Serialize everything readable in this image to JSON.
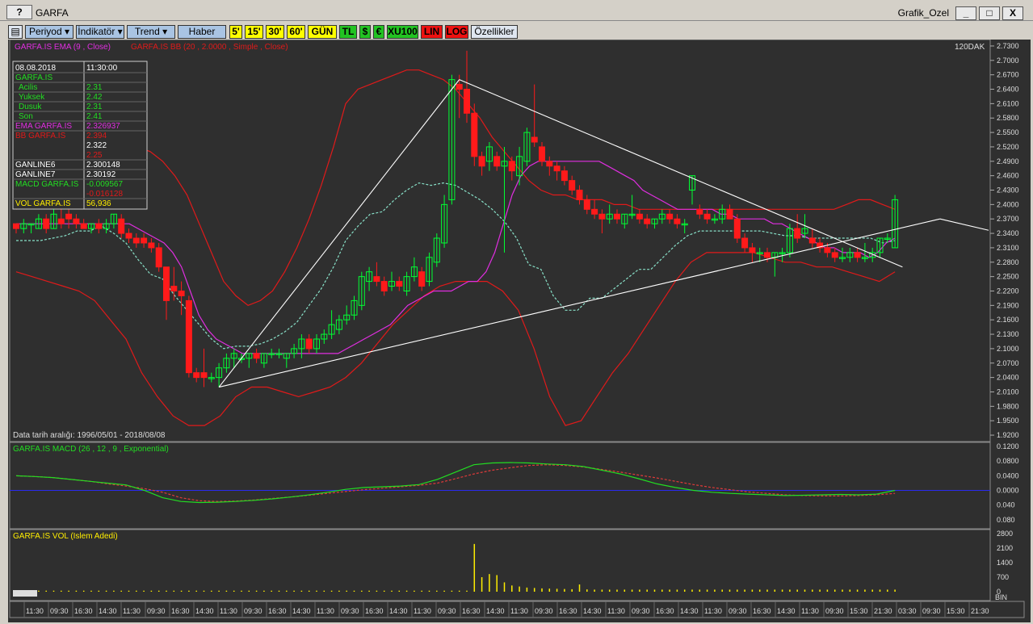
{
  "window": {
    "help_label": "?",
    "symbol": "GARFA",
    "template": "Grafik_Ozel",
    "min_label": "_",
    "max_label": "□",
    "close_label": "X"
  },
  "toolbar": {
    "periyod": "Periyod",
    "indikator": "İndikatör",
    "trend": "Trend",
    "haber": "Haber",
    "p5": "5'",
    "p15": "15'",
    "p30": "30'",
    "p60": "60'",
    "gun": "GÜN",
    "tl": "TL",
    "usd": "$",
    "eur": "€",
    "xu100": "XU100",
    "lin": "LIN",
    "log": "LOG",
    "ozellikler": "Özellikler"
  },
  "main_panel": {
    "legend_ema": "GARFA.IS EMA (9 , Close)",
    "legend_bb": "GARFA.IS BB (20 , 2.0000 , Simple , Close)",
    "interval_label": "120DAK",
    "date_range": "Data tarih aralığı: 1996/05/01 - 2018/08/08"
  },
  "info_box": {
    "date": "08.08.2018",
    "time": "11:30:00",
    "symbol": "GARFA.IS",
    "rows": [
      {
        "label": "Acilis",
        "value": "2.31"
      },
      {
        "label": "Yuksek",
        "value": "2.42"
      },
      {
        "label": "Dusuk",
        "value": "2.31"
      },
      {
        "label": "Son",
        "value": "2.41"
      }
    ],
    "ema_label": "EMA GARFA.IS",
    "ema_value": "2.326937",
    "bb_label": "BB GARFA.IS",
    "bb_upper": "2.394",
    "bb_mid": "2.322",
    "bb_lower": "2.25",
    "ganline6_label": "GANLINE6",
    "ganline6_value": "2.300148",
    "ganline7_label": "GANLINE7",
    "ganline7_value": "2.30192",
    "macd_label": "MACD GARFA.IS",
    "macd_value": "-0.009567",
    "macd_signal": "-0.016128",
    "vol_label": "VOL GARFA.IS",
    "vol_value": "56,936"
  },
  "macd_panel": {
    "legend": "GARFA.IS MACD (26 , 12 , 9 , Exponential)"
  },
  "vol_panel": {
    "legend": "GARFA.IS VOL (Islem Adedi)",
    "unit": "BIN"
  },
  "price_ticks": [
    "2.7300",
    "2.7000",
    "2.6700",
    "2.6400",
    "2.6100",
    "2.5800",
    "2.5500",
    "2.5200",
    "2.4900",
    "2.4600",
    "2.4300",
    "2.4000",
    "2.3700",
    "2.3400",
    "2.3100",
    "2.2800",
    "2.2500",
    "2.2200",
    "2.1900",
    "2.1600",
    "2.1300",
    "2.1000",
    "2.0700",
    "2.0400",
    "2.0100",
    "1.9800",
    "1.9500",
    "1.9200"
  ],
  "macd_ticks": [
    "0.1200",
    "0.0800",
    "0.0400",
    "0.0000",
    "0.040",
    "0.080"
  ],
  "vol_ticks": [
    "2800",
    "2100",
    "1400",
    "700",
    "0"
  ],
  "time_labels": [
    "11:30",
    "09:30",
    "16:30",
    "14:30",
    "11:30",
    "09:30",
    "16:30",
    "14:30",
    "11:30",
    "09:30",
    "16:30",
    "14:30",
    "11:30",
    "09:30",
    "16:30",
    "14:30",
    "11:30",
    "09:30",
    "16:30",
    "14:30",
    "11:30",
    "09:30",
    "16:30",
    "14:30",
    "11:30",
    "09:30",
    "16:30",
    "14:30",
    "11:30",
    "09:30",
    "16:30",
    "14:30",
    "11:30",
    "09:30",
    "15:30",
    "21:30",
    "03:30",
    "09:30",
    "15:30",
    "21:30"
  ],
  "colors": {
    "bg": "#2f2f2f",
    "up": "#00ff33",
    "down": "#ff1a1a",
    "ema": "#e02ee0",
    "bb": "#e01a1a",
    "midband": "#88e0c8",
    "trend": "#ffffff",
    "macd": "#22dd22",
    "signal": "#e03a3a",
    "vol": "#ffee00",
    "zero": "#2a2aee"
  },
  "chart_data": {
    "type": "candlestick",
    "ylim": [
      1.91,
      2.74
    ],
    "candles": [
      [
        2.36,
        2.36,
        2.34,
        2.35
      ],
      [
        2.35,
        2.37,
        2.34,
        2.36
      ],
      [
        2.36,
        2.36,
        2.34,
        2.36
      ],
      [
        2.35,
        2.38,
        2.35,
        2.37
      ],
      [
        2.37,
        2.38,
        2.34,
        2.35
      ],
      [
        2.35,
        2.39,
        2.35,
        2.38
      ],
      [
        2.37,
        2.39,
        2.35,
        2.36
      ],
      [
        2.38,
        2.39,
        2.35,
        2.37
      ],
      [
        2.37,
        2.38,
        2.35,
        2.36
      ],
      [
        2.36,
        2.37,
        2.35,
        2.35
      ],
      [
        2.35,
        2.36,
        2.34,
        2.36
      ],
      [
        2.36,
        2.37,
        2.34,
        2.35
      ],
      [
        2.35,
        2.37,
        2.34,
        2.36
      ],
      [
        2.36,
        2.38,
        2.35,
        2.38
      ],
      [
        2.37,
        2.38,
        2.33,
        2.34
      ],
      [
        2.34,
        2.35,
        2.32,
        2.33
      ],
      [
        2.33,
        2.34,
        2.31,
        2.32
      ],
      [
        2.33,
        2.34,
        2.31,
        2.32
      ],
      [
        2.32,
        2.33,
        2.3,
        2.31
      ],
      [
        2.31,
        2.32,
        2.26,
        2.27
      ],
      [
        2.27,
        2.27,
        2.16,
        2.2
      ],
      [
        2.23,
        2.27,
        2.2,
        2.22
      ],
      [
        2.22,
        2.24,
        2.17,
        2.21
      ],
      [
        2.2,
        2.21,
        2.04,
        2.05
      ],
      [
        2.05,
        2.06,
        2.03,
        2.04
      ],
      [
        2.05,
        2.1,
        2.02,
        2.04
      ],
      [
        2.04,
        2.05,
        2.03,
        2.04
      ],
      [
        2.04,
        2.07,
        2.02,
        2.06
      ],
      [
        2.06,
        2.09,
        2.05,
        2.08
      ],
      [
        2.08,
        2.1,
        2.06,
        2.09
      ],
      [
        2.08,
        2.09,
        2.07,
        2.08
      ],
      [
        2.08,
        2.09,
        2.06,
        2.09
      ],
      [
        2.09,
        2.1,
        2.07,
        2.08
      ],
      [
        2.07,
        2.09,
        2.06,
        2.09
      ],
      [
        2.09,
        2.1,
        2.08,
        2.09
      ],
      [
        2.09,
        2.1,
        2.08,
        2.09
      ],
      [
        2.08,
        2.09,
        2.06,
        2.09
      ],
      [
        2.09,
        2.11,
        2.08,
        2.1
      ],
      [
        2.1,
        2.13,
        2.08,
        2.12
      ],
      [
        2.12,
        2.13,
        2.09,
        2.1
      ],
      [
        2.1,
        2.13,
        2.09,
        2.12
      ],
      [
        2.12,
        2.14,
        2.11,
        2.13
      ],
      [
        2.13,
        2.18,
        2.12,
        2.15
      ],
      [
        2.14,
        2.17,
        2.13,
        2.16
      ],
      [
        2.16,
        2.19,
        2.15,
        2.17
      ],
      [
        2.17,
        2.21,
        2.16,
        2.2
      ],
      [
        2.19,
        2.26,
        2.18,
        2.25
      ],
      [
        2.24,
        2.27,
        2.22,
        2.26
      ],
      [
        2.25,
        2.28,
        2.23,
        2.24
      ],
      [
        2.24,
        2.25,
        2.21,
        2.22
      ],
      [
        2.23,
        2.26,
        2.22,
        2.24
      ],
      [
        2.24,
        2.25,
        2.22,
        2.23
      ],
      [
        2.22,
        2.26,
        2.21,
        2.25
      ],
      [
        2.25,
        2.29,
        2.24,
        2.27
      ],
      [
        2.26,
        2.27,
        2.22,
        2.23
      ],
      [
        2.24,
        2.3,
        2.23,
        2.29
      ],
      [
        2.28,
        2.34,
        2.27,
        2.33
      ],
      [
        2.32,
        2.42,
        2.31,
        2.4
      ],
      [
        2.41,
        2.67,
        2.4,
        2.66
      ],
      [
        2.65,
        2.67,
        2.58,
        2.64
      ],
      [
        2.64,
        2.72,
        2.57,
        2.59
      ],
      [
        2.59,
        2.61,
        2.48,
        2.5
      ],
      [
        2.5,
        2.51,
        2.46,
        2.48
      ],
      [
        2.49,
        2.53,
        2.47,
        2.52
      ],
      [
        2.5,
        2.51,
        2.47,
        2.48
      ],
      [
        2.48,
        2.52,
        2.3,
        2.49
      ],
      [
        2.49,
        2.5,
        2.45,
        2.47
      ],
      [
        2.46,
        2.52,
        2.44,
        2.5
      ],
      [
        2.49,
        2.56,
        2.48,
        2.55
      ],
      [
        2.54,
        2.65,
        2.52,
        2.53
      ],
      [
        2.52,
        2.53,
        2.48,
        2.49
      ],
      [
        2.49,
        2.5,
        2.46,
        2.48
      ],
      [
        2.48,
        2.49,
        2.45,
        2.47
      ],
      [
        2.47,
        2.48,
        2.44,
        2.45
      ],
      [
        2.45,
        2.46,
        2.42,
        2.43
      ],
      [
        2.43,
        2.44,
        2.4,
        2.41
      ],
      [
        2.41,
        2.42,
        2.38,
        2.39
      ],
      [
        2.39,
        2.41,
        2.37,
        2.38
      ],
      [
        2.38,
        2.39,
        2.34,
        2.37
      ],
      [
        2.37,
        2.4,
        2.36,
        2.38
      ],
      [
        2.38,
        2.39,
        2.36,
        2.37
      ],
      [
        2.36,
        2.38,
        2.35,
        2.38
      ],
      [
        2.38,
        2.42,
        2.37,
        2.38
      ],
      [
        2.38,
        2.39,
        2.36,
        2.37
      ],
      [
        2.37,
        2.38,
        2.35,
        2.36
      ],
      [
        2.36,
        2.37,
        2.35,
        2.37
      ],
      [
        2.37,
        2.39,
        2.36,
        2.38
      ],
      [
        2.38,
        2.39,
        2.36,
        2.37
      ],
      [
        2.37,
        2.38,
        2.35,
        2.36
      ],
      [
        2.36,
        2.37,
        2.34,
        2.36
      ],
      [
        2.43,
        2.46,
        2.4,
        2.46
      ],
      [
        2.39,
        2.4,
        2.37,
        2.38
      ],
      [
        2.38,
        2.39,
        2.36,
        2.37
      ],
      [
        2.37,
        2.38,
        2.36,
        2.37
      ],
      [
        2.37,
        2.4,
        2.36,
        2.39
      ],
      [
        2.39,
        2.4,
        2.37,
        2.37
      ],
      [
        2.37,
        2.38,
        2.32,
        2.33
      ],
      [
        2.33,
        2.34,
        2.3,
        2.31
      ],
      [
        2.31,
        2.32,
        2.28,
        2.3
      ],
      [
        2.3,
        2.31,
        2.28,
        2.3
      ],
      [
        2.3,
        2.31,
        2.28,
        2.29
      ],
      [
        2.29,
        2.3,
        2.25,
        2.3
      ],
      [
        2.3,
        2.31,
        2.28,
        2.3
      ],
      [
        2.3,
        2.36,
        2.29,
        2.35
      ],
      [
        2.35,
        2.38,
        2.32,
        2.33
      ],
      [
        2.34,
        2.38,
        2.33,
        2.35
      ],
      [
        2.33,
        2.35,
        2.31,
        2.32
      ],
      [
        2.32,
        2.33,
        2.3,
        2.31
      ],
      [
        2.31,
        2.32,
        2.29,
        2.3
      ],
      [
        2.3,
        2.31,
        2.28,
        2.29
      ],
      [
        2.29,
        2.31,
        2.28,
        2.29
      ],
      [
        2.29,
        2.31,
        2.28,
        2.3
      ],
      [
        2.3,
        2.31,
        2.28,
        2.29
      ],
      [
        2.29,
        2.32,
        2.28,
        2.29
      ],
      [
        2.29,
        2.31,
        2.28,
        2.3
      ],
      [
        2.3,
        2.33,
        2.29,
        2.33
      ],
      [
        2.33,
        2.34,
        2.32,
        2.33
      ],
      [
        2.31,
        2.42,
        2.31,
        2.41
      ]
    ],
    "ema": [
      2.36,
      2.36,
      2.36,
      2.36,
      2.36,
      2.36,
      2.36,
      2.36,
      2.36,
      2.36,
      2.36,
      2.36,
      2.36,
      2.36,
      2.35,
      2.34,
      2.33,
      2.32,
      2.3,
      2.27,
      2.22,
      2.17,
      2.14,
      2.12,
      2.11,
      2.1,
      2.09,
      2.09,
      2.09,
      2.09,
      2.09,
      2.09,
      2.09,
      2.09,
      2.09,
      2.09,
      2.09,
      2.09,
      2.1,
      2.11,
      2.12,
      2.13,
      2.14,
      2.15,
      2.17,
      2.19,
      2.2,
      2.21,
      2.22,
      2.22,
      2.22,
      2.23,
      2.24,
      2.24,
      2.26,
      2.3,
      2.36,
      2.42,
      2.46,
      2.48,
      2.49,
      2.49,
      2.49,
      2.49,
      2.49,
      2.49,
      2.49,
      2.49,
      2.48,
      2.47,
      2.46,
      2.45,
      2.43,
      2.42,
      2.41,
      2.4,
      2.39,
      2.39,
      2.39,
      2.39,
      2.39,
      2.38,
      2.38,
      2.37,
      2.37,
      2.37,
      2.37,
      2.36,
      2.36,
      2.35,
      2.34,
      2.33,
      2.32,
      2.31,
      2.31,
      2.3,
      2.3,
      2.3,
      2.29,
      2.3,
      2.32,
      2.33
    ],
    "bb_upper": [
      2.39,
      2.4,
      2.41,
      2.42,
      2.44,
      2.47,
      2.49,
      2.51,
      2.52,
      2.52,
      2.52,
      2.51,
      2.49,
      2.46,
      2.42,
      2.36,
      2.3,
      2.24,
      2.21,
      2.19,
      2.2,
      2.22,
      2.26,
      2.31,
      2.37,
      2.44,
      2.52,
      2.61,
      2.64,
      2.65,
      2.66,
      2.67,
      2.68,
      2.68,
      2.67,
      2.66,
      2.64,
      2.61,
      2.58,
      2.54,
      2.51,
      2.48,
      2.45,
      2.43,
      2.42,
      2.42,
      2.41,
      2.41,
      2.41,
      2.4,
      2.4,
      2.39,
      2.39,
      2.39,
      2.39,
      2.39,
      2.39,
      2.39,
      2.39,
      2.39,
      2.39,
      2.39,
      2.39,
      2.39,
      2.39,
      2.39,
      2.39,
      2.39,
      2.4,
      2.41,
      2.41,
      2.4,
      2.39
    ],
    "bb_lower": [
      2.26,
      2.25,
      2.24,
      2.23,
      2.22,
      2.2,
      2.16,
      2.12,
      2.05,
      2.0,
      1.96,
      1.94,
      1.94,
      1.96,
      2.0,
      2.02,
      2.02,
      2.01,
      2.0,
      2.01,
      2.02,
      2.04,
      2.07,
      2.11,
      2.15,
      2.18,
      2.21,
      2.23,
      2.24,
      2.24,
      2.24,
      2.22,
      2.18,
      2.1,
      2.0,
      1.94,
      1.95,
      2.0,
      2.05,
      2.09,
      2.14,
      2.19,
      2.24,
      2.28,
      2.3,
      2.3,
      2.3,
      2.3,
      2.29,
      2.28,
      2.28,
      2.27,
      2.27,
      2.26,
      2.25,
      2.24,
      2.26
    ],
    "macd": [
      0.04,
      0.038,
      0.035,
      0.03,
      0.025,
      0.02,
      0.015,
      0.0,
      -0.02,
      -0.03,
      -0.033,
      -0.032,
      -0.03,
      -0.027,
      -0.023,
      -0.018,
      -0.012,
      -0.005,
      0.003,
      0.008,
      0.01,
      0.012,
      0.016,
      0.03,
      0.05,
      0.07,
      0.075,
      0.076,
      0.075,
      0.072,
      0.07,
      0.065,
      0.055,
      0.045,
      0.032,
      0.018,
      0.008,
      0.0,
      -0.005,
      -0.008,
      -0.01,
      -0.012,
      -0.014,
      -0.013,
      -0.012,
      -0.011,
      -0.012,
      -0.01,
      0.0
    ],
    "macd_signal": [
      0.04,
      0.038,
      0.035,
      0.03,
      0.025,
      0.018,
      0.012,
      0.005,
      -0.005,
      -0.02,
      -0.028,
      -0.03,
      -0.029,
      -0.026,
      -0.022,
      -0.018,
      -0.013,
      -0.008,
      -0.003,
      0.002,
      0.006,
      0.01,
      0.014,
      0.02,
      0.032,
      0.045,
      0.055,
      0.062,
      0.068,
      0.07,
      0.068,
      0.064,
      0.057,
      0.05,
      0.042,
      0.034,
      0.025,
      0.016,
      0.008,
      0.002,
      -0.004,
      -0.008,
      -0.012,
      -0.014,
      -0.015,
      -0.015,
      -0.014,
      -0.012,
      -0.008
    ],
    "volume": [
      50,
      50,
      50,
      50,
      50,
      50,
      50,
      50,
      50,
      50,
      50,
      50,
      50,
      50,
      50,
      50,
      50,
      50,
      50,
      50,
      50,
      50,
      50,
      50,
      50,
      50,
      50,
      50,
      50,
      50,
      50,
      50,
      50,
      50,
      50,
      50,
      50,
      50,
      50,
      50,
      50,
      50,
      50,
      50,
      50,
      50,
      50,
      50,
      50,
      50,
      50,
      50,
      50,
      50,
      50,
      50,
      50,
      50,
      50,
      50,
      50,
      2300,
      700,
      850,
      800,
      450,
      300,
      250,
      200,
      180,
      160,
      150,
      140,
      130,
      120,
      350,
      110,
      100,
      100,
      100,
      100,
      100,
      100,
      100,
      100,
      100,
      100,
      100,
      100,
      100,
      100,
      100,
      100,
      100,
      100,
      100,
      100,
      100,
      100,
      100,
      100,
      100,
      100,
      100,
      100,
      100,
      100,
      100,
      100,
      100,
      100,
      100,
      100,
      100,
      100,
      100,
      100,
      100
    ],
    "trendlines": [
      {
        "from": [
          27,
          2.02
        ],
        "to": [
          59,
          2.66
        ]
      },
      {
        "from": [
          59,
          2.66
        ],
        "to": [
          118,
          2.27
        ]
      },
      {
        "from": [
          27,
          2.02
        ],
        "to": [
          123,
          2.37
        ]
      }
    ]
  }
}
